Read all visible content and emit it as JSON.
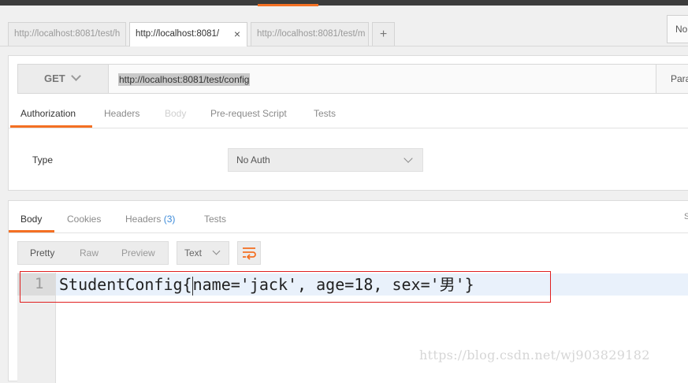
{
  "tabs": [
    {
      "label": "http://localhost:8081/test/h",
      "active": false
    },
    {
      "label": "http://localhost:8081/",
      "active": true,
      "close": "×"
    },
    {
      "label": "http://localhost:8081/test/m",
      "active": false
    }
  ],
  "tab_add_label": "+",
  "environment": {
    "label": "No"
  },
  "request": {
    "method": "GET",
    "url": "http://localhost:8081/test/config",
    "params_label": "Para"
  },
  "request_tabs": [
    {
      "label": "Authorization",
      "state": "active"
    },
    {
      "label": "Headers",
      "state": "normal"
    },
    {
      "label": "Body",
      "state": "disabled"
    },
    {
      "label": "Pre-request Script",
      "state": "normal"
    },
    {
      "label": "Tests",
      "state": "normal"
    }
  ],
  "auth": {
    "type_label": "Type",
    "value": "No Auth"
  },
  "response_tabs": {
    "body": "Body",
    "cookies": "Cookies",
    "headers": "Headers",
    "headers_count": "(3)",
    "tests": "Tests",
    "status_cut": "S"
  },
  "view_modes": [
    "Pretty",
    "Raw",
    "Preview"
  ],
  "format": "Text",
  "editor": {
    "line_number": "1",
    "content_before_cursor": "StudentConfig{",
    "content_after_cursor": "name='jack', age=18, sex='男'}"
  },
  "watermark": "https://blog.csdn.net/wj903829182",
  "colors": {
    "accent": "#f47023",
    "highlight_box": "#e02020",
    "count_link": "#3b8ad9"
  }
}
